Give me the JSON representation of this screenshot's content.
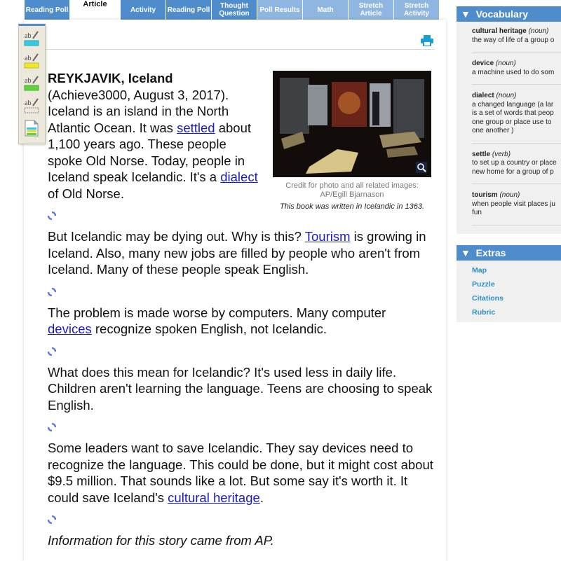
{
  "tabs": [
    {
      "label": "Reading Poll",
      "state": "normal"
    },
    {
      "label": "Article",
      "state": "active"
    },
    {
      "label": "Activity",
      "state": "normal"
    },
    {
      "label": "Reading Poll",
      "state": "normal"
    },
    {
      "label": "Thought Question",
      "state": "normal"
    },
    {
      "label": "Poll Results",
      "state": "disabled"
    },
    {
      "label": "Math",
      "state": "disabled"
    },
    {
      "label": "Stretch Article",
      "state": "disabled"
    },
    {
      "label": "Stretch Activity",
      "state": "disabled"
    }
  ],
  "toolbar": {
    "tools": [
      {
        "name": "highlight-blue",
        "color": "#35c8e6"
      },
      {
        "name": "highlight-yellow",
        "color": "#f2e82a"
      },
      {
        "name": "highlight-green",
        "color": "#62d23a"
      },
      {
        "name": "highlight-erase",
        "color": "none"
      },
      {
        "name": "notes",
        "color": "multi"
      }
    ]
  },
  "article": {
    "dateline": "REYKJAVIK, Iceland",
    "p1_a": "(Achieve3000, August 3, 2017). Iceland is an island in the North Atlantic Ocean. It was ",
    "p1_link1": "settled",
    "p1_b": " about 1,100 years ago. These people spoke Old Norse. Today, people in Iceland speak Icelandic. It's a ",
    "p1_link2": "dialect",
    "p1_c": " of Old Norse.",
    "p2_a": "But Icelandic may be dying out. Why is this? ",
    "p2_link": "Tourism",
    "p2_b": " is growing in Iceland. Also, many new jobs are filled by people who aren't from Iceland. Many of these people speak English.",
    "p3_a": "The problem is made worse by computers. Many computer ",
    "p3_link": "devices",
    "p3_b": " recognize spoken English, not Icelandic.",
    "p4": "What does this mean for Icelandic? It's used less in daily life. Children aren't learning the language. Teens are choosing to speak English.",
    "p5_a": "Some leaders want to save Icelandic. They say devices need to recognize the language. This could be done, but it might cost about $9.5 million. That sounds like a lot. But some say it's worth it. It could save Iceland's ",
    "p5_link": "cultural heritage",
    "p5_b": ".",
    "source": "Information for this story came from AP."
  },
  "photo": {
    "credit": "Credit for photo and all related images: AP/Egill Bjarnason",
    "caption": "This book was written in Icelandic in 1363."
  },
  "sidebar": {
    "vocab_title": "Vocabulary",
    "vocab": [
      {
        "term": "cultural heritage",
        "pos": "(noun)",
        "def": [
          "the way of life of a group o"
        ]
      },
      {
        "term": "device",
        "pos": "(noun)",
        "def": [
          "a machine used to do som"
        ]
      },
      {
        "term": "dialect",
        "pos": "(noun)",
        "def": [
          "a changed language (a lar",
          "is a set of words that peop",
          "one group or place use to",
          "one another )"
        ]
      },
      {
        "term": "settle",
        "pos": "(verb)",
        "def": [
          "to set up a country or place",
          "new home for a group of p"
        ]
      },
      {
        "term": "tourism",
        "pos": "(noun)",
        "def": [
          "when people visit places ju",
          "fun"
        ]
      }
    ],
    "extras_title": "Extras",
    "extras": [
      "Map",
      "Puzzle",
      "Citations",
      "Rubric"
    ]
  },
  "colors": {
    "tab_blue": "#4f8ccc",
    "tab_disabled": "#8fb6e0",
    "link": "#1a1acc",
    "extras_link": "#2a8fc8"
  }
}
